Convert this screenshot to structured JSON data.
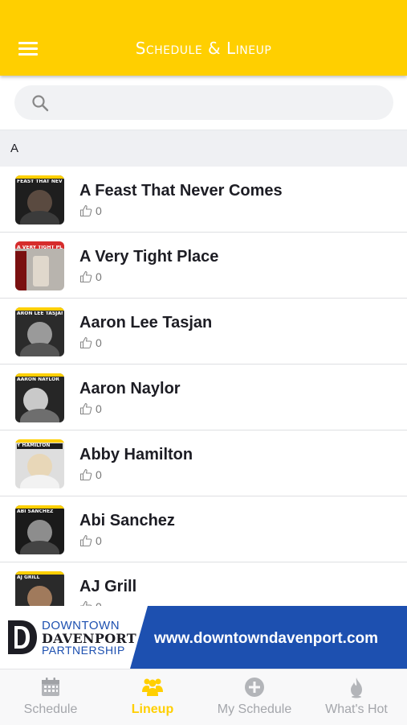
{
  "header": {
    "title": "Schedule & Lineup"
  },
  "search": {
    "placeholder": ""
  },
  "section": {
    "letter": "A"
  },
  "artists": [
    {
      "name": "A Feast That Never Comes",
      "likes": "0",
      "caption": "FEAST THAT NEVER COMES"
    },
    {
      "name": "A Very Tight Place",
      "likes": "0",
      "caption": "A VERY TIGHT PLACE"
    },
    {
      "name": "Aaron Lee Tasjan",
      "likes": "0",
      "caption": "ARON LEE TASJAN"
    },
    {
      "name": "Aaron Naylor",
      "likes": "0",
      "caption": "AARON NAYLOR"
    },
    {
      "name": "Abby Hamilton",
      "likes": "0",
      "caption": "Y HAMILTON"
    },
    {
      "name": "Abi Sanchez",
      "likes": "0",
      "caption": "ABI SANCHEZ"
    },
    {
      "name": "AJ Grill",
      "likes": "0",
      "caption": "AJ GRILL"
    }
  ],
  "banner": {
    "logo_line1": "DOWNTOWN",
    "logo_line2": "DAVENPORT",
    "logo_line3": "PARTNERSHIP",
    "url": "www.downtowndavenport.com"
  },
  "nav": {
    "items": [
      {
        "label": "Schedule",
        "icon": "calendar-icon",
        "active": false
      },
      {
        "label": "Lineup",
        "icon": "people-icon",
        "active": true
      },
      {
        "label": "My Schedule",
        "icon": "plus-circle-icon",
        "active": false
      },
      {
        "label": "What's Hot",
        "icon": "flame-icon",
        "active": false
      }
    ]
  },
  "colors": {
    "accent": "#ffcf00",
    "brand_blue": "#1d50b0",
    "nav_inactive": "#a4a6ab"
  }
}
